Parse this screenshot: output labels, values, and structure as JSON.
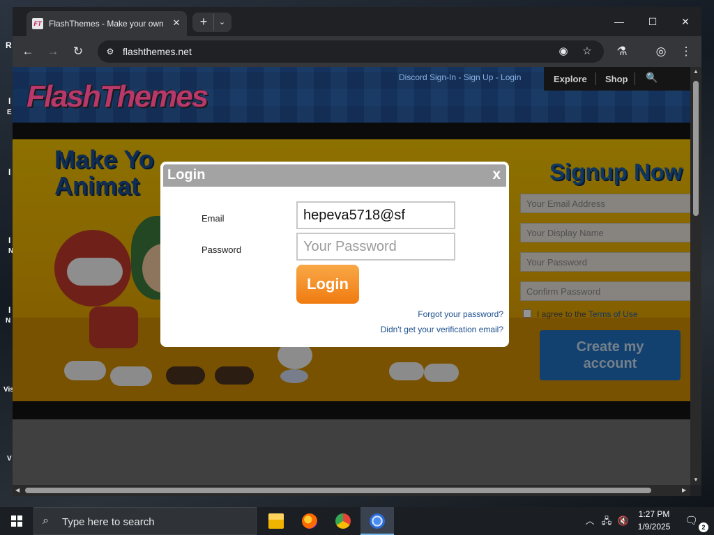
{
  "desktop": {
    "left_letters": [
      "R",
      "I",
      "E",
      "I",
      "I",
      "N",
      "I",
      "N",
      "Vis",
      "V"
    ]
  },
  "browser": {
    "tab_title": "FlashThemes - Make your own",
    "tab_favicon": "FT",
    "tab_close": "✕",
    "new_tab": "+",
    "tab_search": "⌄",
    "window_controls": {
      "minimize": "—",
      "maximize": "☐",
      "close": "✕"
    },
    "back": "←",
    "forward": "→",
    "reload": "↻",
    "site_info": "⚙",
    "url": "flashthemes.net",
    "omnibox_icons": {
      "eye": "◉",
      "star": "☆"
    },
    "labs": "⚗",
    "profile": "◎",
    "menu": "⋮"
  },
  "site": {
    "logo": "FlashThemes",
    "auth_links": "Discord Sign-In - Sign Up - Login",
    "nav": {
      "explore": "Explore",
      "shop": "Shop",
      "search": "🔍"
    },
    "hero_title_line1": "Make Yo",
    "hero_title_line2": "Animat",
    "signup": {
      "title": "Signup Now",
      "email_placeholder": "Your Email Address",
      "display_name_placeholder": "Your Display Name",
      "password_placeholder": "Your Password",
      "confirm_placeholder": "Confirm Password",
      "agree_text": "I agree to the",
      "agree_link": "Terms of Use",
      "create_button_line1": "Create my",
      "create_button_line2": "account"
    }
  },
  "login_modal": {
    "title": "Login",
    "close": "x",
    "email_label": "Email",
    "email_value": "hepeva5718@sf",
    "password_label": "Password",
    "password_placeholder": "Your Password",
    "login_button": "Login",
    "forgot_link": "Forgot your password?",
    "verification_link": "Didn't get your verification email?"
  },
  "taskbar": {
    "search_placeholder": "Type here to search",
    "search_icon": "⌕",
    "apps": [
      "file-explorer",
      "firefox",
      "chrome",
      "chrome-active"
    ],
    "tray_chevron": "︿",
    "network": "🖧",
    "volume": "🔇",
    "time": "1:27 PM",
    "date": "1/9/2025",
    "notifications_icon": "🗨",
    "notifications_count": "2"
  }
}
